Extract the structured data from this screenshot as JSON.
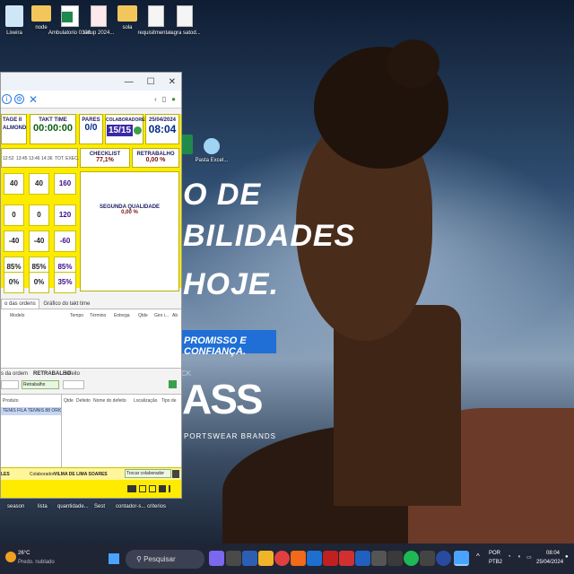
{
  "desktop": {
    "icons": [
      {
        "label": "Lixeira",
        "icon": "recycle-bin-icon"
      },
      {
        "label": "node",
        "icon": "folder-icon"
      },
      {
        "label": "Ambulatorio 0308 CP tu...",
        "icon": "spreadsheet-icon"
      },
      {
        "label": "setup 2024...",
        "icon": "database-file-icon"
      },
      {
        "label": "sola",
        "icon": "folder-icon"
      },
      {
        "label": "requisitmenta...",
        "icon": "document-icon"
      },
      {
        "label": "regra satod...",
        "icon": "document-icon"
      }
    ],
    "side_icons": [
      {
        "label": "",
        "icon": "excel-icon"
      },
      {
        "label": "Pasta Excel...",
        "icon": "chrome-app-icon"
      }
    ],
    "bottom_labels": [
      "season",
      "lista",
      "quantidade...",
      "Sest",
      "contador-s...",
      "criterios"
    ]
  },
  "wallpaper_ad": {
    "line1": "O DE",
    "line2": "BILIDADES",
    "line3": "HOJE.",
    "tag": "PROMISSO E CONFIANÇA.",
    "small": "CK",
    "brand": "ASS",
    "sub": "PORTSWEAR BRANDS"
  },
  "app": {
    "titlebar": {
      "minimize": "—",
      "maximize": "☐",
      "close": "✕"
    },
    "toolbar": {
      "right_left": "‹",
      "right_mid": "▯",
      "right_ind": "●"
    },
    "header": {
      "line_title": "TAGE II",
      "line_sub": "ALMOND",
      "takt_label": "TAKT TIME",
      "takt_value": "00:00:00",
      "pares_label": "PARES",
      "pares_value": "0/0",
      "colab_label": "COLABORADORES",
      "colab_value": "15/15",
      "date": "25/04/2024",
      "time": "08:04"
    },
    "hour_headers": [
      "12:52",
      "13:45",
      "13:46",
      "14:36",
      "TOT. EXEC."
    ],
    "rows": [
      [
        "40",
        "40",
        "160"
      ],
      [
        "0",
        "0",
        "120"
      ],
      [
        "-40",
        "-40",
        "-60"
      ],
      [
        "85%",
        "85%",
        "85%"
      ],
      [
        "0%",
        "0%",
        "35%"
      ]
    ],
    "checklist": {
      "label": "CHECKLIST",
      "value": "77,1%"
    },
    "retrabalho": {
      "label": "RETRABALHO",
      "value": "0,00 %"
    },
    "segunda": {
      "label": "SEGUNDA QUALIDADE",
      "value": "0,00 %"
    },
    "tabs": [
      "o das ordens",
      "Gráfico do takt time"
    ],
    "grid_headers": [
      "Modelo",
      "Tempo",
      "Término",
      "Entrega",
      "Qtde",
      "Giro i...",
      "Ab"
    ],
    "filter": {
      "ordem_label": "s da ordem",
      "retrabalho_label": "RETRABALHO",
      "defeito_label": "Defeito",
      "retrabalho_btn": "Retrabalho"
    },
    "lower_headers_left": [
      "Produto"
    ],
    "lower_headers_right": [
      "Qtde",
      "Defeito",
      "Nome do defeito",
      "Localização",
      "Tipo de"
    ],
    "selected_product": "TENIS FILA TENNIS 88 ORIGEN",
    "status": {
      "left": "LES",
      "colab_label": "Colaborador:",
      "colab_name": "VILMA DE LIMA SOARES",
      "trocar_btn": "Trocar colaborador"
    }
  },
  "taskbar": {
    "weather_temp": "26°C",
    "weather_desc": "Predo. nublado",
    "search": "Pesquisar",
    "lang1": "POR",
    "lang2": "PTB2",
    "time": "08:04",
    "date": "25/04/2024"
  }
}
